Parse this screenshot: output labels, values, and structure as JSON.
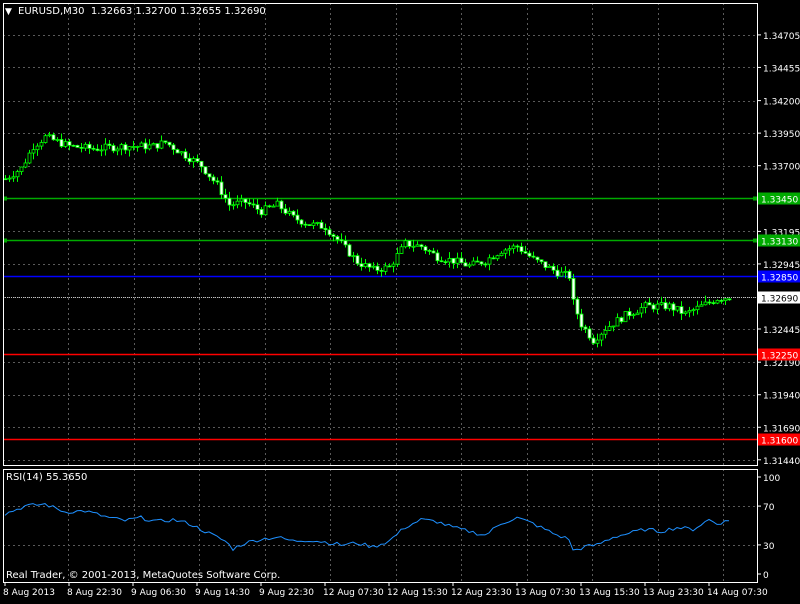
{
  "header": {
    "collapse_glyph": "▼",
    "symbol_line": "EURUSD,M30  1.32663 1.32700 1.32655 1.32690"
  },
  "footer": {
    "copyright": "Real Trader, © 2001-2013, MetaQuotes Software Corp."
  },
  "colors": {
    "background": "#000000",
    "frame": "#ffffff",
    "grid": "#5a5a5a",
    "bull_candle": "#00ff00",
    "rsi_line": "#1e90ff",
    "support_line": "#00aa00",
    "mid_line": "#0000ff",
    "resistance_line": "#ff0000",
    "bid_line": "#c0c0c0"
  },
  "chart_data": [
    {
      "type": "line",
      "title": "EURUSD,M30",
      "ohlc": {
        "open": 1.32663,
        "high": 1.327,
        "low": 1.32655,
        "close": 1.3269
      },
      "ylim": [
        1.314,
        1.3495
      ],
      "y_ticks": [
        "1.34705",
        "1.34455",
        "1.34200",
        "1.33950",
        "1.33700",
        "1.33450",
        "1.33195",
        "1.32945",
        "1.32690",
        "1.32445",
        "1.32190",
        "1.31940",
        "1.31690",
        "1.31440"
      ],
      "y_tick_values": [
        1.34705,
        1.34455,
        1.342,
        1.3395,
        1.337,
        1.3345,
        1.33195,
        1.32945,
        1.3269,
        1.32445,
        1.3219,
        1.3194,
        1.3169,
        1.3144
      ],
      "x_ticks": [
        "8 Aug 2013",
        "8 Aug 22:30",
        "9 Aug 06:30",
        "9 Aug 14:30",
        "9 Aug 22:30",
        "12 Aug 07:30",
        "12 Aug 15:30",
        "12 Aug 23:30",
        "13 Aug 07:30",
        "13 Aug 15:30",
        "13 Aug 23:30",
        "14 Aug 07:30"
      ],
      "x_tick_index": [
        0,
        16,
        32,
        48,
        64,
        80,
        96,
        112,
        128,
        144,
        160,
        176
      ],
      "bar_count": 182,
      "price_anchors": [
        [
          0,
          1.336
        ],
        [
          4,
          1.3368
        ],
        [
          7,
          1.3385
        ],
        [
          10,
          1.3392
        ],
        [
          16,
          1.3385
        ],
        [
          22,
          1.3383
        ],
        [
          30,
          1.3385
        ],
        [
          37,
          1.3385
        ],
        [
          40,
          1.3388
        ],
        [
          45,
          1.3378
        ],
        [
          49,
          1.337
        ],
        [
          53,
          1.3355
        ],
        [
          56,
          1.334
        ],
        [
          60,
          1.3342
        ],
        [
          64,
          1.3335
        ],
        [
          68,
          1.334
        ],
        [
          72,
          1.333
        ],
        [
          76,
          1.3325
        ],
        [
          80,
          1.3323
        ],
        [
          84,
          1.331
        ],
        [
          88,
          1.3296
        ],
        [
          92,
          1.329
        ],
        [
          96,
          1.3292
        ],
        [
          100,
          1.331
        ],
        [
          104,
          1.3308
        ],
        [
          108,
          1.33
        ],
        [
          112,
          1.3297
        ],
        [
          116,
          1.3293
        ],
        [
          120,
          1.3297
        ],
        [
          124,
          1.3305
        ],
        [
          128,
          1.3308
        ],
        [
          132,
          1.3298
        ],
        [
          135,
          1.3293
        ],
        [
          138,
          1.3288
        ],
        [
          141,
          1.3285
        ],
        [
          142,
          1.3265
        ],
        [
          144,
          1.3248
        ],
        [
          147,
          1.3236
        ],
        [
          150,
          1.3245
        ],
        [
          155,
          1.3255
        ],
        [
          160,
          1.3262
        ],
        [
          166,
          1.3262
        ],
        [
          170,
          1.3256
        ],
        [
          174,
          1.3262
        ],
        [
          178,
          1.3268
        ],
        [
          181,
          1.3269
        ]
      ],
      "hlines": [
        {
          "value": 1.3345,
          "label": "1.33450",
          "role": "support"
        },
        {
          "value": 1.3313,
          "label": "1.33130",
          "role": "support"
        },
        {
          "value": 1.3285,
          "label": "1.32850",
          "role": "mid"
        },
        {
          "value": 1.3269,
          "label": "1.32690",
          "role": "bid"
        },
        {
          "value": 1.3225,
          "label": "1.32250",
          "role": "resistance"
        },
        {
          "value": 1.316,
          "label": "1.31600",
          "role": "resistance"
        }
      ]
    },
    {
      "type": "line",
      "title": "RSI(14) 55.3650",
      "ylim": [
        0,
        100
      ],
      "y_ticks": [
        "100",
        "70",
        "30",
        "0"
      ],
      "y_tick_values": [
        100,
        70,
        30,
        0
      ],
      "anchors": [
        [
          0,
          62
        ],
        [
          5,
          70
        ],
        [
          10,
          72
        ],
        [
          15,
          64
        ],
        [
          20,
          65
        ],
        [
          26,
          58
        ],
        [
          30,
          55
        ],
        [
          34,
          58
        ],
        [
          38,
          54
        ],
        [
          42,
          56
        ],
        [
          46,
          52
        ],
        [
          49,
          46
        ],
        [
          52,
          40
        ],
        [
          55,
          34
        ],
        [
          57,
          26
        ],
        [
          60,
          32
        ],
        [
          64,
          36
        ],
        [
          68,
          38
        ],
        [
          72,
          34
        ],
        [
          76,
          35
        ],
        [
          80,
          33
        ],
        [
          84,
          30
        ],
        [
          88,
          32
        ],
        [
          92,
          28
        ],
        [
          96,
          34
        ],
        [
          100,
          48
        ],
        [
          104,
          56
        ],
        [
          108,
          54
        ],
        [
          112,
          48
        ],
        [
          116,
          44
        ],
        [
          120,
          40
        ],
        [
          124,
          52
        ],
        [
          128,
          58
        ],
        [
          132,
          52
        ],
        [
          135,
          46
        ],
        [
          138,
          40
        ],
        [
          141,
          36
        ],
        [
          142,
          24
        ],
        [
          145,
          28
        ],
        [
          148,
          30
        ],
        [
          152,
          38
        ],
        [
          156,
          42
        ],
        [
          160,
          46
        ],
        [
          164,
          44
        ],
        [
          168,
          48
        ],
        [
          172,
          46
        ],
        [
          176,
          56
        ],
        [
          178,
          52
        ],
        [
          181,
          55
        ]
      ]
    }
  ]
}
